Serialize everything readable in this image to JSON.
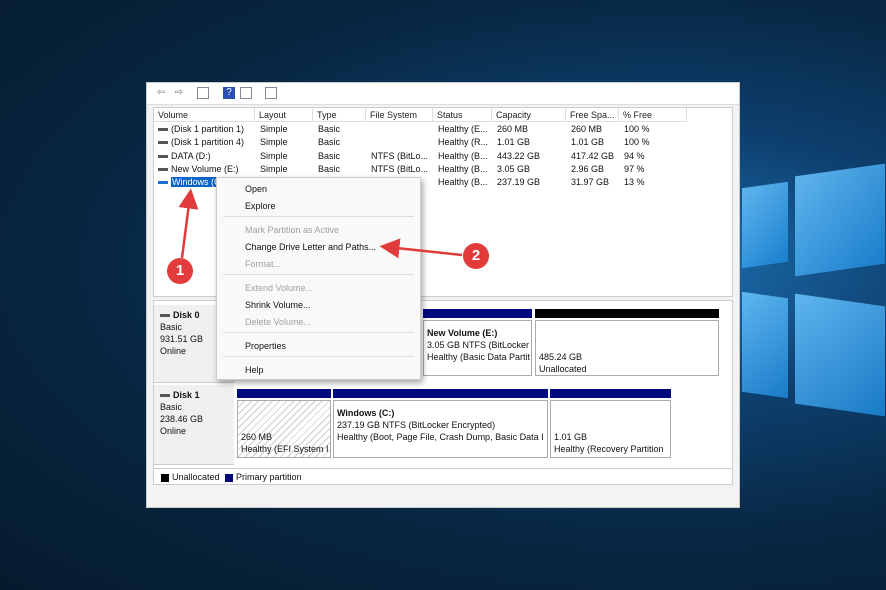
{
  "columns": [
    "Volume",
    "Layout",
    "Type",
    "File System",
    "Status",
    "Capacity",
    "Free Spa...",
    "% Free"
  ],
  "rows": [
    [
      "(Disk 1 partition 1)",
      "Simple",
      "Basic",
      "",
      "Healthy (E...",
      "260 MB",
      "260 MB",
      "100 %"
    ],
    [
      "(Disk 1 partition 4)",
      "Simple",
      "Basic",
      "",
      "Healthy (R...",
      "1.01 GB",
      "1.01 GB",
      "100 %"
    ],
    [
      "DATA (D:)",
      "Simple",
      "Basic",
      "NTFS (BitLo...",
      "Healthy (B...",
      "443.22 GB",
      "417.42 GB",
      "94 %"
    ],
    [
      "New Volume (E:)",
      "Simple",
      "Basic",
      "NTFS (BitLo...",
      "Healthy (B...",
      "3.05 GB",
      "2.96 GB",
      "97 %"
    ],
    [
      "Windows (C",
      "",
      "",
      "",
      "Healthy (B...",
      "237.19 GB",
      "31.97 GB",
      "13 %"
    ]
  ],
  "disks": [
    {
      "name": "Disk 0",
      "type": "Basic",
      "size": "931.51 GB",
      "status": "Online",
      "partitions": [
        {
          "title": "New Volume  (E:)",
          "line1": "3.05 GB NTFS (BitLocker E",
          "line2": "Healthy (Basic Data Partit"
        },
        {
          "title": "",
          "line1": "485.24 GB",
          "line2": "Unallocated"
        }
      ]
    },
    {
      "name": "Disk 1",
      "type": "Basic",
      "size": "238.46 GB",
      "status": "Online",
      "partitions": [
        {
          "title": "",
          "line1": "260 MB",
          "line2": "Healthy (EFI System I"
        },
        {
          "title": "Windows  (C:)",
          "line1": "237.19 GB NTFS (BitLocker Encrypted)",
          "line2": "Healthy (Boot, Page File, Crash Dump, Basic Data I"
        },
        {
          "title": "",
          "line1": "1.01 GB",
          "line2": "Healthy (Recovery Partition"
        }
      ]
    }
  ],
  "legend": {
    "unallocated": "Unallocated",
    "primary": "Primary partition",
    "unallocated_color": "#000000",
    "primary_color": "#00087e"
  },
  "menu": [
    {
      "label": "Open",
      "disabled": false
    },
    {
      "label": "Explore",
      "disabled": false
    },
    {
      "label": "Mark Partition as Active",
      "disabled": true
    },
    {
      "label": "Change Drive Letter and Paths...",
      "disabled": false
    },
    {
      "label": "Format...",
      "disabled": true
    },
    {
      "label": "Extend Volume...",
      "disabled": true
    },
    {
      "label": "Shrink Volume...",
      "disabled": false
    },
    {
      "label": "Delete Volume...",
      "disabled": true
    },
    {
      "label": "Properties",
      "disabled": false
    },
    {
      "label": "Help",
      "disabled": false
    }
  ],
  "annotations": {
    "step1": "1",
    "step2": "2",
    "color": "#e23b3b"
  }
}
